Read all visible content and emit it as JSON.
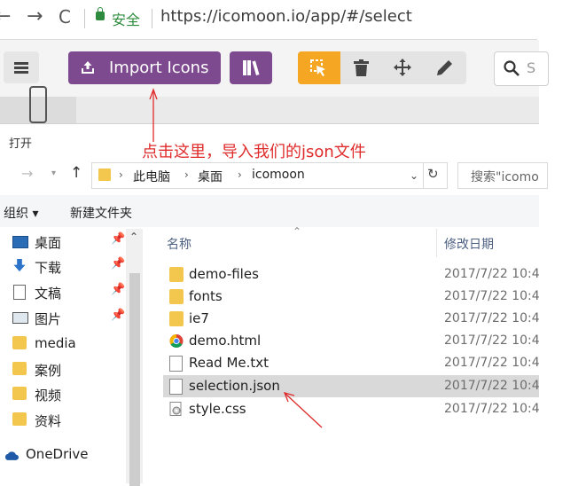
{
  "browser": {
    "secure_label": "安全",
    "url": "https://icomoon.io/app/#/select",
    "nav_glyphs": [
      "←",
      "→",
      "C"
    ]
  },
  "toolbar": {
    "import_label": "Import Icons",
    "search_placeholder": "S",
    "accent_color": "#7e4a8f",
    "active_tool_color": "#f5a623",
    "tools": [
      "select-icon",
      "trash-icon",
      "move-icon",
      "pencil-icon"
    ]
  },
  "explorer": {
    "dialog_title": "打开",
    "breadcrumb": [
      "此电脑",
      "桌面",
      "icomoon"
    ],
    "search_placeholder": "搜索\"icomo",
    "cmd_organize": "组织 ▾",
    "cmd_new_folder": "新建文件夹",
    "nav_items": [
      {
        "label": "桌面",
        "icon": "desktop-icon",
        "pinned": true
      },
      {
        "label": "下载",
        "icon": "download-icon",
        "pinned": true
      },
      {
        "label": "文稿",
        "icon": "document-icon",
        "pinned": true
      },
      {
        "label": "图片",
        "icon": "picture-icon",
        "pinned": true
      },
      {
        "label": "media",
        "icon": "folder-icon",
        "pinned": false
      },
      {
        "label": "案例",
        "icon": "folder-icon",
        "pinned": false
      },
      {
        "label": "视频",
        "icon": "folder-icon",
        "pinned": false
      },
      {
        "label": "资料",
        "icon": "folder-icon",
        "pinned": false
      },
      {
        "label": "OneDrive",
        "icon": "cloud-icon",
        "pinned": false
      }
    ],
    "columns": {
      "name": "名称",
      "date": "修改日期"
    },
    "files": [
      {
        "name": "demo-files",
        "date": "2017/7/22 10:4",
        "type": "folder"
      },
      {
        "name": "fonts",
        "date": "2017/7/22 10:4",
        "type": "folder"
      },
      {
        "name": "ie7",
        "date": "2017/7/22 10:4",
        "type": "folder"
      },
      {
        "name": "demo.html",
        "date": "2017/7/22 10:4",
        "type": "chrome"
      },
      {
        "name": "Read Me.txt",
        "date": "2017/7/22 10:4",
        "type": "text"
      },
      {
        "name": "selection.json",
        "date": "2017/7/22 10:4",
        "type": "json",
        "selected": true
      },
      {
        "name": "style.css",
        "date": "2017/7/22 10:4",
        "type": "css"
      }
    ]
  },
  "annotation": {
    "text": "点击这里，导入我们的json文件",
    "color": "#e02b2b"
  }
}
